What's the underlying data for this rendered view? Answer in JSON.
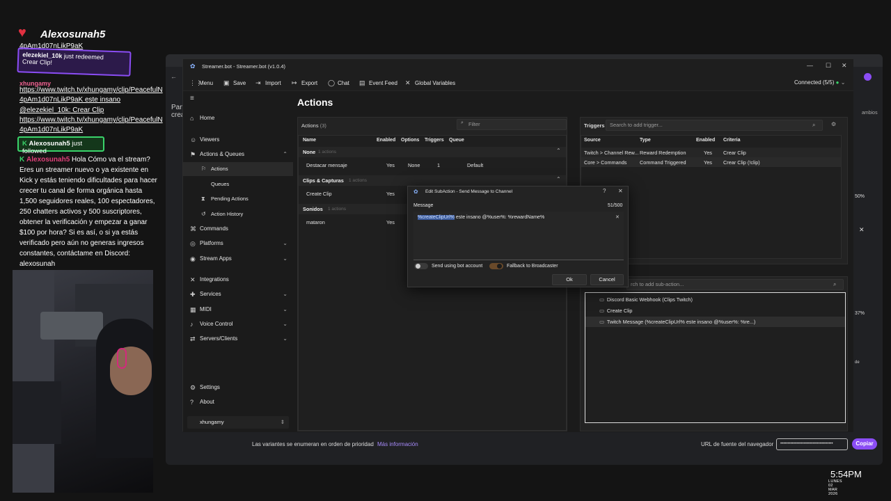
{
  "overlay": {
    "streamer_name": "Alexosunah5",
    "chat": {
      "top_link": "4pAm1d07nLikP9aK",
      "redeem_user": "elezekiel_10k",
      "redeem_text": "just redeemed",
      "redeem_reward": "Crear Clip!",
      "msg1_user": "xhungamy",
      "msg1_link1": "https://www.twitch.tv/xhungamy/clip/PeacefulN",
      "msg1_link2": "4pAm1d07nLikP9aK este insano",
      "msg1_line3": "@elezekiel_10k: Crear Clip",
      "msg1_link3": "https://www.twitch.tv/xhungamy/clip/PeacefulN",
      "msg1_link4": "4pAm1d07nLikP9aK",
      "follow_user": "Alexosunah5",
      "follow_text": "just followed",
      "msg2_user": "Alexosunah5",
      "msg2_lines": [
        "Hola Cómo va el stream?",
        "Eres un streamer nuevo o ya existente en",
        "Kick y estás teniendo dificultades para hacer",
        "crecer tu canal de forma orgánica hasta",
        "1,500 seguidores reales, 100 espectadores,",
        "250 chatters activos y 500 suscriptores,",
        "obtener la verificación y empezar a ganar",
        "$100 por hora? Si es así, o si ya estás",
        "verificado pero aún no generas ingresos",
        "constantes, contáctame en Discord:",
        "alexosunah"
      ]
    },
    "clock": "5:54PM",
    "date": "LUNES 02 MAR 2026"
  },
  "browser": {
    "side_labels": [
      "Pane",
      "crea"
    ],
    "right_labels": [
      "ambios",
      "50%",
      "37%",
      "de"
    ],
    "bottom_text": "Las variantes se enumeran en orden de prioridad",
    "bottom_link": "Más información",
    "url_label": "URL de fuente del navegador",
    "url_value": "••••••••••••••••••••••••••••••••••••",
    "copy_button": "Copiar"
  },
  "app": {
    "title": "Streamer.bot - Streamer.bot (v1.0.4)",
    "connection": "Connected (5/5)",
    "accent": "#8b4df5",
    "toolbar": {
      "menu": "Menu",
      "save": "Save",
      "import": "Import",
      "export": "Export",
      "chat": "Chat",
      "event_feed": "Event Feed",
      "global_variables": "Global Variables"
    },
    "nav": {
      "home": "Home",
      "viewers": "Viewers",
      "actions_queues": "Actions & Queues",
      "actions": "Actions",
      "queues": "Queues",
      "pending_actions": "Pending Actions",
      "action_history": "Action History",
      "commands": "Commands",
      "platforms": "Platforms",
      "stream_apps": "Stream Apps",
      "integrations": "Integrations",
      "services": "Services",
      "midi": "MIDI",
      "voice_control": "Voice Control",
      "servers_clients": "Servers/Clients",
      "settings": "Settings",
      "about": "About",
      "user": "xhungamy"
    },
    "page_title": "Actions",
    "actions_panel": {
      "label": "Actions",
      "count": "(3)",
      "filter_placeholder": "Filter",
      "columns": [
        "Name",
        "Enabled",
        "Options",
        "Triggers",
        "Queue"
      ],
      "groups": [
        {
          "name": "None",
          "count": "1 actions",
          "rows": [
            {
              "name": "Destacar mensaje",
              "enabled": "Yes",
              "options": "None",
              "triggers": "1",
              "queue": "Default"
            }
          ]
        },
        {
          "name": "Clips & Capturas",
          "count": "1 actions",
          "rows": [
            {
              "name": "Create Clip",
              "enabled": "Yes"
            }
          ]
        },
        {
          "name": "Sonidos",
          "count": "1 actions",
          "rows": [
            {
              "name": "mataron",
              "enabled": "Yes"
            }
          ]
        }
      ]
    },
    "triggers_panel": {
      "label": "Triggers",
      "search_placeholder": "Search to add trigger...",
      "columns": [
        "Source",
        "Type",
        "Enabled",
        "Criteria"
      ],
      "rows": [
        {
          "source": "Twitch > Channel Rew...",
          "type": "Reward Redemption",
          "enabled": "Yes",
          "criteria": "Crear Clip"
        },
        {
          "source": "Core > Commands",
          "type": "Command Triggered",
          "enabled": "Yes",
          "criteria": "Crear Clip (!clip)"
        }
      ]
    },
    "subactions_panel": {
      "search_placeholder": "rch to add sub-action...",
      "items": [
        "Discord Basic Webhook (Clips Twitch)",
        "Create Clip",
        "Twitch Message (%createClipUrl% este insano @%user%: %re...)"
      ]
    },
    "dialog": {
      "title": "Edit SubAction - Send Message to Channel",
      "message_label": "Message",
      "char_count": "51/500",
      "message_selected": "%createClipUrl%",
      "message_rest": " este insano @%user%: %rewardName%",
      "send_bot_label": "Send using bot account",
      "send_bot_on": false,
      "fallback_label": "Fallback to Broadcaster",
      "fallback_on": true,
      "ok": "Ok",
      "cancel": "Cancel"
    }
  }
}
